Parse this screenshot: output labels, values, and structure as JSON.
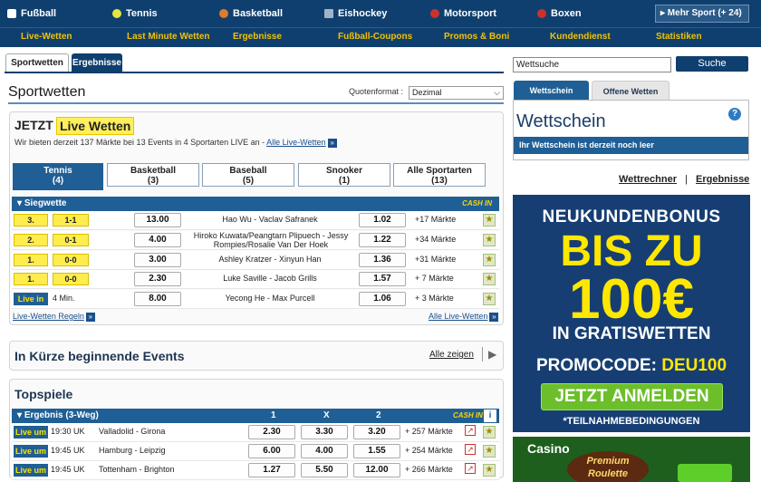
{
  "nav": {
    "sports": [
      {
        "label": "Fußball",
        "color": "#ffffff"
      },
      {
        "label": "Tennis",
        "color": "#e6e640"
      },
      {
        "label": "Basketball",
        "color": "#e07a2c"
      },
      {
        "label": "Eishockey",
        "color": "#9fb3c8"
      },
      {
        "label": "Motorsport",
        "color": "#c8332c"
      },
      {
        "label": "Boxen",
        "color": "#d0302a"
      }
    ],
    "more": "▸ Mehr Sport (+ 24)",
    "sub": [
      "Live-Wetten",
      "Last Minute Wetten",
      "Ergebnisse",
      "Fußball-Coupons",
      "Promos & Boni",
      "Kundendienst",
      "Statistiken"
    ]
  },
  "tabs": {
    "sportwetten": "Sportwetten",
    "ergebnisse": "Ergebnisse"
  },
  "page": {
    "title": "Sportwetten",
    "quotenformat_label": "Quotenformat :",
    "quotenformat_value": "Dezimal"
  },
  "live": {
    "jetzt": "JETZT",
    "badge": "Live Wetten",
    "info_text": "Wir bieten derzeit 137 Märkte bei 13 Events in 4 Sportarten LIVE an -",
    "all_link": "Alle Live-Wetten",
    "sport_tabs": [
      {
        "name": "Tennis",
        "count": "(4)"
      },
      {
        "name": "Basketball",
        "count": "(3)"
      },
      {
        "name": "Baseball",
        "count": "(5)"
      },
      {
        "name": "Snooker",
        "count": "(1)"
      },
      {
        "name": "Alle Sportarten",
        "count": "(13)"
      }
    ],
    "bar_label": "Siegwette",
    "cashin": "CASH IN",
    "rows": [
      {
        "set": "3.",
        "score": "1-1",
        "odd1": "13.00",
        "match": "Hao Wu  -  Vaclav Safranek",
        "odd2": "1.02",
        "markets": "+17 Märkte"
      },
      {
        "set": "2.",
        "score": "0-1",
        "odd1": "4.00",
        "match": "Hiroko Kuwata/Peangtarn Plipuech  -  Jessy Rompies/Rosalie Van Der Hoek",
        "odd2": "1.22",
        "markets": "+34 Märkte"
      },
      {
        "set": "1.",
        "score": "0-0",
        "odd1": "3.00",
        "match": "Ashley Kratzer  -  Xinyun Han",
        "odd2": "1.36",
        "markets": "+31 Märkte"
      },
      {
        "set": "1.",
        "score": "0-0",
        "odd1": "2.30",
        "match": "Luke Saville  -  Jacob Grills",
        "odd2": "1.57",
        "markets": "+ 7 Märkte"
      },
      {
        "set": "Live in",
        "score": "4 Min.",
        "odd1": "8.00",
        "match": "Yecong He  -  Max Purcell",
        "odd2": "1.06",
        "markets": "+ 3 Märkte"
      }
    ],
    "rules_link": "Live-Wetten Regeln",
    "all_link2": "Alle Live-Wetten"
  },
  "soon": {
    "title": "In Kürze beginnende Events",
    "link": "Alle zeigen"
  },
  "top": {
    "title": "Topspiele",
    "bar_label": "Ergebnis (3-Weg)",
    "cols": [
      "1",
      "X",
      "2"
    ],
    "cashin": "CASH IN",
    "rows": [
      {
        "badge": "Live um",
        "time": "19:30 UK",
        "match": "Valladolid  -  Girona",
        "o1": "2.30",
        "ox": "3.30",
        "o2": "3.20",
        "markets": "+ 257 Märkte"
      },
      {
        "badge": "Live um",
        "time": "19:45 UK",
        "match": "Hamburg  -  Leipzig",
        "o1": "6.00",
        "ox": "4.00",
        "o2": "1.55",
        "markets": "+ 254 Märkte"
      },
      {
        "badge": "Live um",
        "time": "19:45 UK",
        "match": "Tottenham  -  Brighton",
        "o1": "1.27",
        "ox": "5.50",
        "o2": "12.00",
        "markets": "+ 266 Märkte"
      }
    ]
  },
  "right": {
    "search_value": "Wettsuche",
    "search_button": "Suche",
    "tab_active": "Wettschein",
    "tab_inactive": "Offene Wetten",
    "wettschein_title": "Wettschein",
    "wettschein_empty": "Ihr Wettschein ist derzeit noch leer",
    "link1": "Wettrechner",
    "sep": "|",
    "link2": "Ergebnisse"
  },
  "banner": {
    "line1": "NEUKUNDENBONUS",
    "line2": "BIS ZU",
    "line3": "100€",
    "line4": "IN GRATISWETTEN",
    "promo_label": "PROMOCODE:",
    "promo_code": "DEU100",
    "cta": "JETZT ANMELDEN",
    "fine": "*TEILNAHMEBEDINGUNGEN"
  },
  "casino": {
    "label": "Casino",
    "game": "Premium Roulette"
  }
}
